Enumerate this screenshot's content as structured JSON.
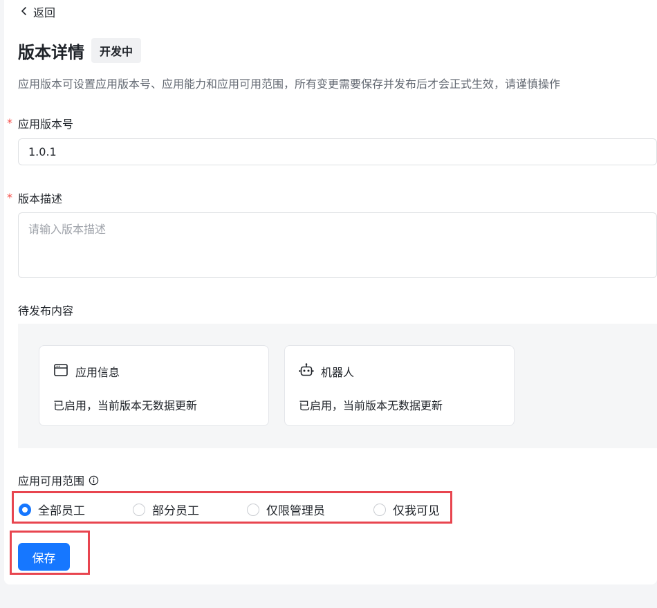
{
  "nav": {
    "back_label": "返回"
  },
  "header": {
    "title": "版本详情",
    "status_badge": "开发中"
  },
  "description": "应用版本可设置应用版本号、应用能力和应用可用范围，所有变更需要保存并发布后才会正式生效，请谨慎操作",
  "version_field": {
    "required_mark": "*",
    "label": "应用版本号",
    "value": "1.0.1"
  },
  "description_field": {
    "required_mark": "*",
    "label": "版本描述",
    "placeholder": "请输入版本描述"
  },
  "pending": {
    "label": "待发布内容",
    "items": [
      {
        "title": "应用信息",
        "status": "已启用，当前版本无数据更新",
        "icon": "app-window-icon"
      },
      {
        "title": "机器人",
        "status": "已启用，当前版本无数据更新",
        "icon": "robot-icon"
      }
    ]
  },
  "scope": {
    "label": "应用可用范围",
    "info_icon": "info-icon",
    "options": [
      {
        "label": "全部员工",
        "selected": true
      },
      {
        "label": "部分员工",
        "selected": false
      },
      {
        "label": "仅限管理员",
        "selected": false
      },
      {
        "label": "仅我可见",
        "selected": false
      }
    ]
  },
  "actions": {
    "save_label": "保存"
  },
  "colors": {
    "primary": "#1677ff",
    "required": "#f54a45",
    "highlight": "#e8454f"
  }
}
